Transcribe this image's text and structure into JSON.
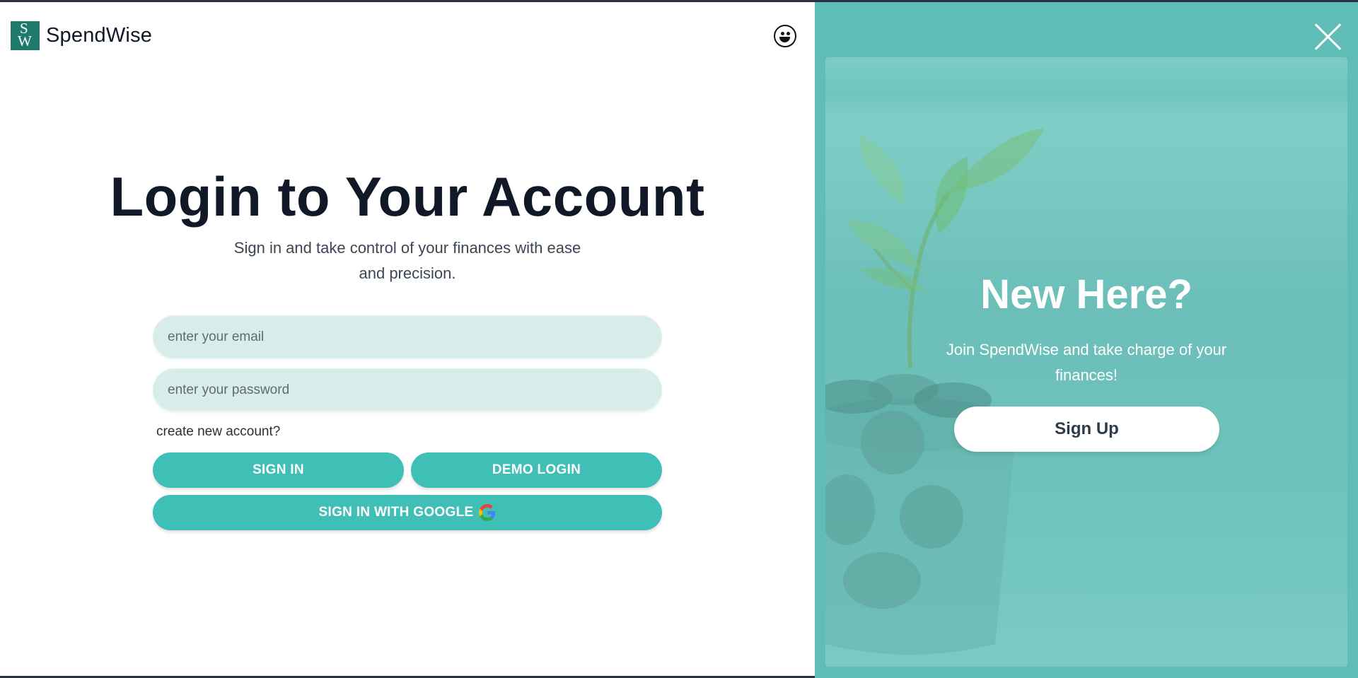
{
  "brand": {
    "logo_letters_top": "S",
    "logo_letters_bottom": "W",
    "name": "SpendWise"
  },
  "header": {
    "theme_icon": "smiley-face-icon"
  },
  "login": {
    "title": "Login to Your Account",
    "subtitle": "Sign in and take control of your finances with ease and precision.",
    "email_placeholder": "enter your email",
    "email_value": "",
    "password_placeholder": "enter your password",
    "password_value": "",
    "create_account_link": "create new account?",
    "signin_label": "SIGN IN",
    "demo_label": "DEMO LOGIN",
    "google_label": "SIGN IN WITH GOOGLE",
    "google_icon": "google-g-icon"
  },
  "signup_panel": {
    "close_icon": "close-icon",
    "title": "New Here?",
    "text": "Join SpendWise and take charge of your finances!",
    "button_label": "Sign Up",
    "background_image": "plant-growing-from-coins-in-glass-jar"
  },
  "colors": {
    "accent": "#3fbfb6",
    "panel": "#5fbcb6",
    "input_bg": "#d8ecea",
    "heading": "#111827",
    "logo": "#1f7a6c"
  }
}
